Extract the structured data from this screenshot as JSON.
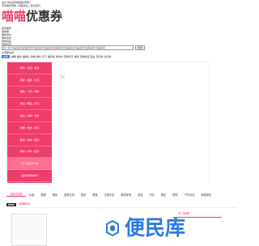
{
  "topbar": {
    "line1": "您好,欢迎来到喵喵优惠券!",
    "line2": "手机看优惠券 | 收藏本站 | 联系我们"
  },
  "logo": {
    "accent": "喵喵",
    "rest": "优惠券"
  },
  "categories": [
    "首页推荐",
    "猫狗粮",
    "猫咪零食",
    "狗狗零食",
    "宠物用品",
    "宠物玩具"
  ],
  "search": {
    "tabs": [
      "综合",
      "淘宝",
      "天猫",
      "京东",
      "拼多多"
    ],
    "placeholder": "搜一搜:商品名称/店铺名称/商品链接/商品名称/店铺名称/商品链接/商品名称/店铺名称/商品链接",
    "button": "搜索"
  },
  "hint": "大家都在搜:",
  "hot": {
    "tag": "热搜",
    "text": "猫粮 猫砂 猫罐头 狗粮 猫条 冻干 猫抓板 狗零食 宠物玩具 猫窝 宠物用品 驱虫 营养膏 化毛膏"
  },
  "sidemenu": [
    "服饰 / 女装 / 男装",
    "母婴 / 童装 / 玩具",
    "美妆 / 个护 / 洗护",
    "鞋包 / 饰品 / 手表",
    "食品 / 生鲜 / 零食",
    "家居 / 家纺 / 家具",
    "数码 / 家电 / 配件",
    "运动 / 户外 / 健身",
    "热门品牌排行榜",
    "最新优惠券排行",
    "今日超值推荐"
  ],
  "nav": [
    "全部优惠券",
    "女装",
    "母婴",
    "美妆",
    "居家日用",
    "鞋品",
    "美食",
    "文娱车品",
    "数码家电",
    "男装",
    "内衣",
    "箱包",
    "配饰",
    "户外运动",
    "家装家纺"
  ],
  "section": {
    "badge": "NEW",
    "title": "品牌特卖"
  },
  "rank": "热门品牌",
  "watermark": "便民库",
  "colors": {
    "accent": "#f03c69",
    "watermark": "#2a7ae2"
  }
}
